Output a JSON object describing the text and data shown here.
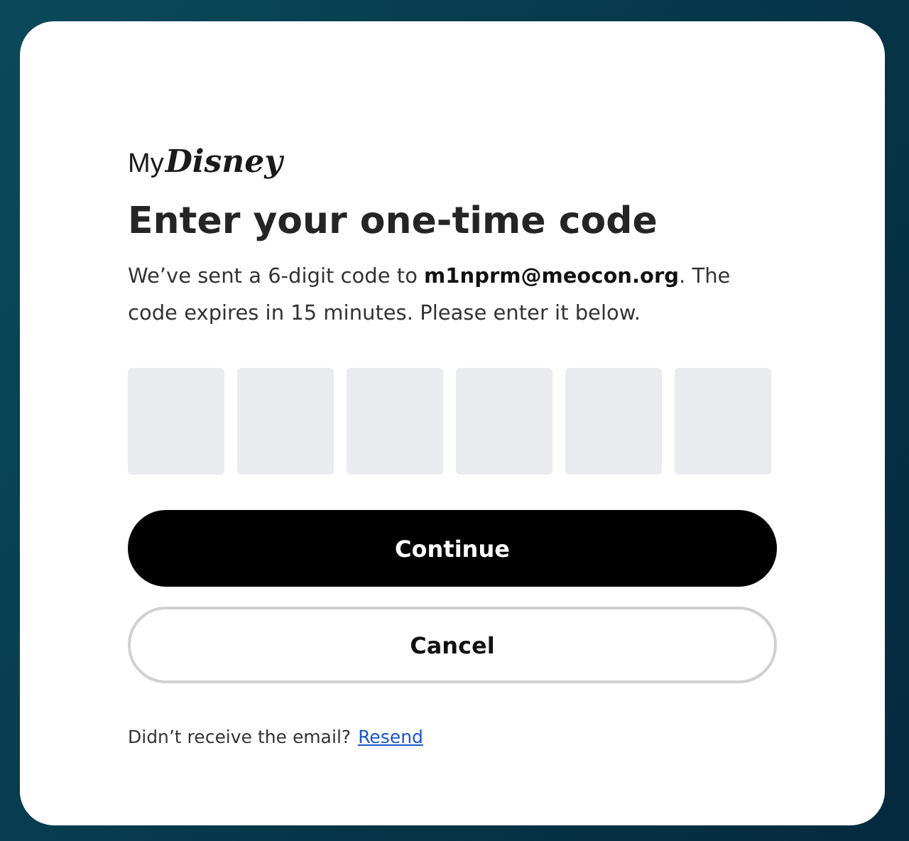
{
  "logo": {
    "prefix": "My",
    "name": "Disney"
  },
  "title": "Enter your one-time code",
  "message": "We’ve sent a 6-digit code to **m1nprm@meocon.org**. The code expires in 15 minutes. Please enter it below.",
  "code_fields": [
    {
      "kind": "digit"
    },
    {
      "kind": "digit"
    },
    {
      "kind": "digit"
    },
    {
      "kind": "digit"
    },
    {
      "kind": "digit"
    },
    {
      "kind": "digit"
    }
  ],
  "buttons": [
    {
      "label": "Continue",
      "kind": "primary"
    },
    {
      "label": "Cancel",
      "kind": "secondary"
    }
  ],
  "footer": {
    "text": "Didn’t receive the email?",
    "link": "Resend"
  }
}
